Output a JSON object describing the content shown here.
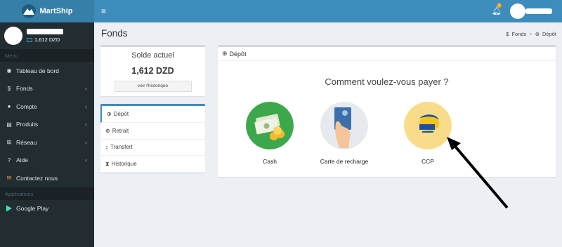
{
  "app": {
    "name": "MartShip"
  },
  "topbar": {
    "menu_icon": "hamburger-icon",
    "notification_count": "2"
  },
  "user": {
    "balance": "1,612 DZD"
  },
  "sidebar": {
    "section_menu": "Menu",
    "items": [
      {
        "label": "Tableau de bord",
        "icon": "dashboard-icon",
        "has_children": false
      },
      {
        "label": "Fonds",
        "icon": "dollar-icon",
        "has_children": true
      },
      {
        "label": "Compte",
        "icon": "user-icon",
        "has_children": true
      },
      {
        "label": "Produits",
        "icon": "cart-icon",
        "has_children": true
      },
      {
        "label": "Réseau",
        "icon": "network-icon",
        "has_children": true
      },
      {
        "label": "Aide",
        "icon": "question-icon",
        "has_children": true
      },
      {
        "label": "Contactez nous",
        "icon": "envelope-icon",
        "has_children": false
      }
    ],
    "section_apps": "Applications",
    "apps": [
      {
        "label": "Google Play",
        "icon": "google-play-icon"
      }
    ]
  },
  "content": {
    "title": "Fonds",
    "breadcrumb": [
      "Fonds",
      "Dépôt"
    ]
  },
  "balance_box": {
    "title": "Solde actuel",
    "value": "1,612 DZD",
    "history_button": "voir l'historique"
  },
  "funds_menu": [
    {
      "label": "Dépôt",
      "active": true
    },
    {
      "label": "Retrait",
      "active": false
    },
    {
      "label": "Transfert",
      "active": false
    },
    {
      "label": "Historique",
      "active": false
    }
  ],
  "depot": {
    "header": "Dépôt",
    "question": "Comment voulez-vous payer ?",
    "options": [
      {
        "label": "Cash",
        "icon": "cash-icon",
        "color": "#3da74b"
      },
      {
        "label": "Carte de recharge",
        "icon": "recharge-card-icon",
        "color": "#e6e9ee"
      },
      {
        "label": "CCP",
        "icon": "algerie-poste-icon",
        "color": "#f8dc8a"
      }
    ]
  },
  "colors": {
    "sidebar": "#222d32",
    "topbar": "#3c8dbc",
    "logo_bar": "#367fa9",
    "accent": "#3c8dbc"
  }
}
